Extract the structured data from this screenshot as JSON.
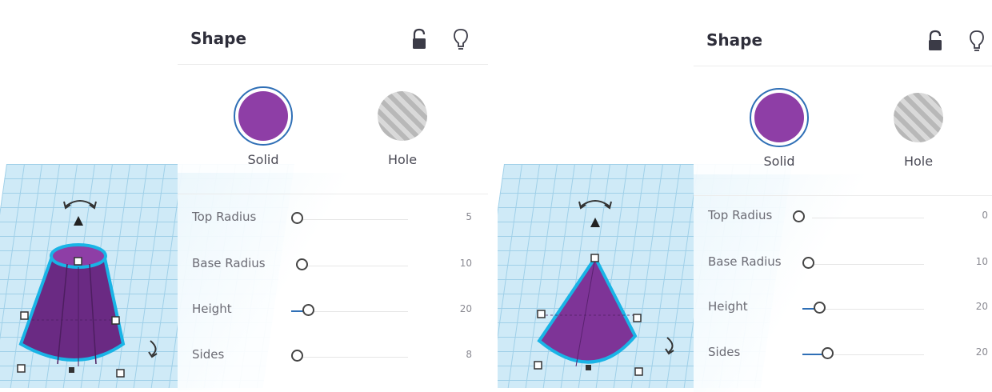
{
  "panes": [
    {
      "panel": {
        "title": "Shape",
        "modes": [
          {
            "label": "Solid",
            "color": "#8e3ea6",
            "selected": true
          },
          {
            "label": "Hole",
            "color": "#c4c4c4",
            "selected": false
          }
        ],
        "params": [
          {
            "label": "Top Radius",
            "value": "5",
            "level": 0.0
          },
          {
            "label": "Base Radius",
            "value": "10",
            "level": 0.03
          },
          {
            "label": "Height",
            "value": "20",
            "level": 0.12
          },
          {
            "label": "Sides",
            "value": "8",
            "level": 0.0
          }
        ]
      },
      "shape": "truncated-cone"
    },
    {
      "panel": {
        "title": "Shape",
        "modes": [
          {
            "label": "Solid",
            "color": "#8e3ea6",
            "selected": true
          },
          {
            "label": "Hole",
            "color": "#c4c4c4",
            "selected": false
          }
        ],
        "params": [
          {
            "label": "Top Radius",
            "value": "0",
            "level": 0.0
          },
          {
            "label": "Base Radius",
            "value": "10",
            "level": 0.03
          },
          {
            "label": "Height",
            "value": "20",
            "level": 0.12
          },
          {
            "label": "Sides",
            "value": "20",
            "level": 0.2
          }
        ]
      },
      "shape": "cone"
    }
  ],
  "colors": {
    "accent": "#2f6fb6",
    "solid": "#8e3ea6",
    "outline": "#19b4e6",
    "grid": "#cfeaf7"
  }
}
